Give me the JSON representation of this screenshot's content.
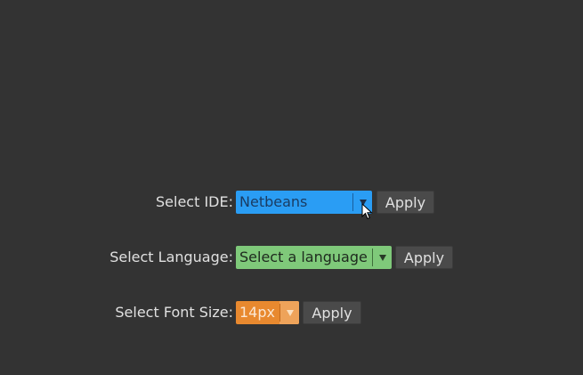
{
  "rows": {
    "ide": {
      "label": "Select IDE:",
      "selected": "Netbeans",
      "apply": "Apply",
      "color": "#2a9df4"
    },
    "language": {
      "label": "Select Language:",
      "selected": "Select a language",
      "apply": "Apply",
      "color": "#7fc97a"
    },
    "font_size": {
      "label": "Select Font Size:",
      "selected": "14px",
      "apply": "Apply",
      "color": "#e8892f"
    }
  },
  "icons": {
    "dropdown_arrow": "chevron-down-icon",
    "cursor": "mouse-pointer-icon"
  }
}
